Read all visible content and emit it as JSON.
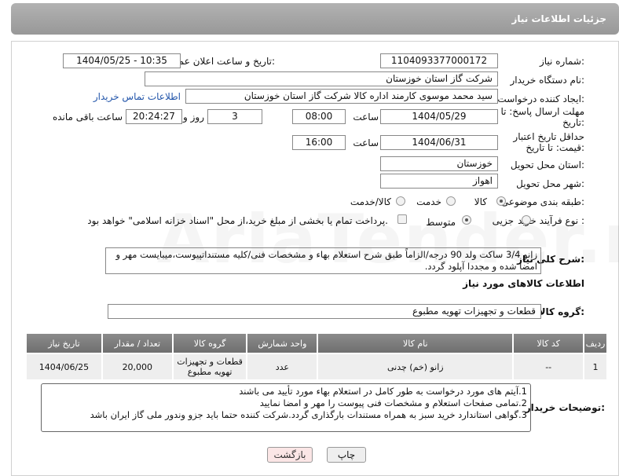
{
  "header": {
    "title": "جزئیات اطلاعات نیاز"
  },
  "fields": {
    "need_number_label": "شماره نیاز:",
    "need_number": "1104093377000172",
    "announce_label": "تاریخ و ساعت اعلان عمومی:",
    "announce_value": "1404/05/25 - 10:35",
    "buyer_org_label": "نام دستگاه خریدار:",
    "buyer_org": "شرکت گاز استان خوزستان",
    "creator_label": "ایجاد کننده درخواست:",
    "creator": "سید محمد موسوی کارمند اداره کالا شرکت گاز استان خوزستان",
    "contact_link": "اطلاعات تماس خریدار",
    "reply_deadline_label": "مهلت ارسال پاسخ: تا تاریخ:",
    "reply_date": "1404/05/29",
    "time_label": "ساعت",
    "reply_time": "08:00",
    "days": "3",
    "days_label": "روز و",
    "remaining_time": "20:24:27",
    "remaining_label": "ساعت باقی مانده",
    "price_validity_label": "حداقل تاریخ اعتبار قیمت: تا تاریخ:",
    "price_date": "1404/06/31",
    "price_time": "16:00",
    "province_label": "استان محل تحویل:",
    "province": "خوزستان",
    "city_label": "شهر محل تحویل:",
    "city": "اهواز",
    "category_label": "طبقه بندی موضوعی:",
    "category_options": [
      "کالا",
      "خدمت",
      "کالا/خدمت"
    ],
    "process_label": "نوع فرآیند خرید :",
    "process_options": [
      "جزیی",
      "متوسط"
    ],
    "payment_note": "پرداخت تمام یا بخشی از مبلغ خرید،از محل \"اسناد خزانه اسلامی\" خواهد بود.",
    "description_label": "شرح کلی نیاز:",
    "description": "زانو 3/4 ساکت ولد 90 درجه/الزاماً طبق شرح استعلام بهاء و مشخصات فنی/کلیه مستنداتپیوست،میبایست مهر و امضا شده و مجددا آپلود گردد.",
    "goods_info_title": "اطلاعات کالاهای مورد نیاز",
    "goods_group_label": "گروه کالا:",
    "goods_group": "قطعات و تجهیزات تهویه مطبوع"
  },
  "table": {
    "headers": [
      "ردیف",
      "کد کالا",
      "نام کالا",
      "واحد شمارش",
      "گروه کالا",
      "تعداد / مقدار",
      "تاریخ نیاز"
    ],
    "rows": [
      [
        "1",
        "--",
        "زانو (خم) چدنی",
        "عدد",
        "قطعات و تجهیزات تهویه مطبوع",
        "20,000",
        "1404/06/25"
      ]
    ]
  },
  "notes": {
    "label": "توضیحات خریدار:",
    "lines": [
      "1.آیتم های مورد درخواست به طور کامل در استعلام بهاء مورد تأیید می باشند",
      "2.تمامی صفحات استعلام و مشخصات فنی پیوست را مهر و امضا نمایید",
      "3.گواهی استاندارد خرید سبز به همراه مستندات بارگذاری گردد.شرکت کننده حتما باید جزو وندور ملی گاز ایران باشد"
    ]
  },
  "buttons": {
    "print": "چاپ",
    "back": "بازگشت"
  }
}
